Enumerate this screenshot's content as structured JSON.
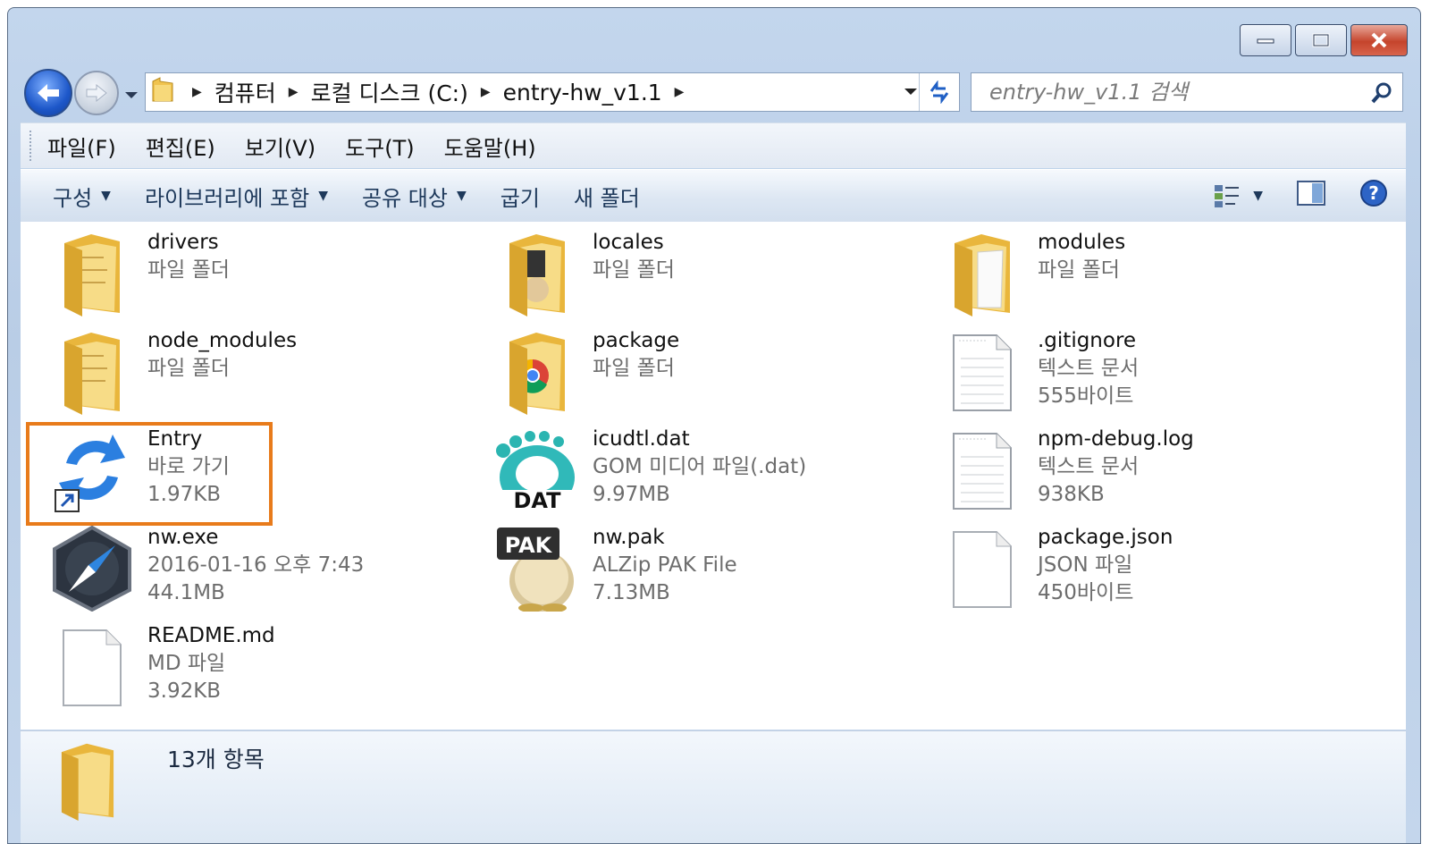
{
  "address": {
    "crumbs": [
      "컴퓨터",
      "로컬 디스크 (C:)",
      "entry-hw_v1.1"
    ]
  },
  "search": {
    "placeholder": "entry-hw_v1.1 검색"
  },
  "menu": [
    "파일(F)",
    "편집(E)",
    "보기(V)",
    "도구(T)",
    "도움말(H)"
  ],
  "toolbar": {
    "organize": "구성",
    "include_library": "라이브러리에 포함",
    "share": "공유 대상",
    "burn": "굽기",
    "new_folder": "새 폴더"
  },
  "files": [
    {
      "name": "drivers",
      "line1": "파일 폴더",
      "line2": "",
      "icon": "folder-icon"
    },
    {
      "name": "locales",
      "line1": "파일 폴더",
      "line2": "",
      "icon": "folder-icon"
    },
    {
      "name": "modules",
      "line1": "파일 폴더",
      "line2": "",
      "icon": "folder-icon"
    },
    {
      "name": "node_modules",
      "line1": "파일 폴더",
      "line2": "",
      "icon": "folder-icon"
    },
    {
      "name": "package",
      "line1": "파일 폴더",
      "line2": "",
      "icon": "folder-icon"
    },
    {
      "name": ".gitignore",
      "line1": "텍스트 문서",
      "line2": "555바이트",
      "icon": "text-document-icon"
    },
    {
      "name": "Entry",
      "line1": "바로 가기",
      "line2": "1.97KB",
      "icon": "shortcut-icon"
    },
    {
      "name": "icudtl.dat",
      "line1": "GOM 미디어 파일(.dat)",
      "line2": "9.97MB",
      "icon": "dat-file-icon"
    },
    {
      "name": "npm-debug.log",
      "line1": "텍스트 문서",
      "line2": "938KB",
      "icon": "text-document-icon"
    },
    {
      "name": "nw.exe",
      "line1": "2016-01-16 오후 7:43",
      "line2": "44.1MB",
      "icon": "nw-app-icon"
    },
    {
      "name": "nw.pak",
      "line1": "ALZip PAK File",
      "line2": "7.13MB",
      "icon": "pak-file-icon"
    },
    {
      "name": "package.json",
      "line1": "JSON 파일",
      "line2": "450바이트",
      "icon": "blank-document-icon"
    },
    {
      "name": "README.md",
      "line1": "MD 파일",
      "line2": "3.92KB",
      "icon": "blank-document-icon"
    }
  ],
  "status": {
    "count": "13개 항목"
  },
  "icons": {
    "dat_label": "DAT",
    "pak_label": "PAK"
  }
}
